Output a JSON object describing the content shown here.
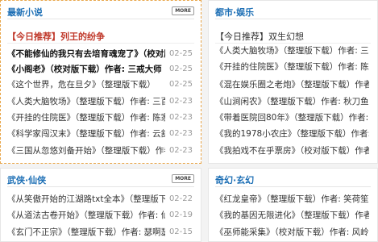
{
  "more_label": "MORE",
  "panels": [
    {
      "title": "最新小说",
      "featured": "【今日推荐】列王的纷争",
      "items": [
        {
          "title": "《不能修仙的我只有去培育魂宠了》（校对版",
          "date": "02-25",
          "hot": true
        },
        {
          "title": "《小阁老》（校对版下载）作者: 三戒大师",
          "date": "02-25",
          "hot": true
        },
        {
          "title": "《这个世界，危在旦夕》（整理版下载）",
          "date": "02-25"
        },
        {
          "title": "《人类大脑牧场》（整理版下载）作者: 三百",
          "date": "02-23"
        },
        {
          "title": "《开挂的住院医》（整理版下载）作者: 陈家",
          "date": "02-23"
        },
        {
          "title": "《科学家闯汉末》（整理版下载）作者: 云舒兄",
          "date": "02-23"
        },
        {
          "title": "《三国从忽悠刘备开始》（整理版下载）作者",
          "date": "02-23"
        }
      ]
    },
    {
      "title": "都市·娱乐",
      "featured": "【今日推荐】双生幻想",
      "items": [
        {
          "title": "《人类大脑牧场》（整理版下载）作者: 三百"
        },
        {
          "title": "《开挂的住院医》（整理版下载）作者: 陈家"
        },
        {
          "title": "《混在娱乐圈之老炮》（整理版下载）作者"
        },
        {
          "title": "《山涧闲农》（整理版下载）作者: 秋刀鱼鱼"
        },
        {
          "title": "《带着医院回80年》（整理版下载）作者: 辣饺"
        },
        {
          "title": "《我的1978小农庄》（整理版下载）作者: 名窑"
        },
        {
          "title": "《我拍戏不在乎票房》（校对版下载）作者"
        }
      ]
    },
    {
      "title": "武侠·仙侠",
      "items": [
        {
          "title": "《从笑傲开始的江湖路txt全本》（整理版下载",
          "date": "02-22"
        },
        {
          "title": "《从道法古卷开始》（整理版下载）作者: 仙先",
          "date": "02-19"
        },
        {
          "title": "《玄门不正宗》（整理版下载）作者: 瑟啊瑟",
          "date": "02-15"
        }
      ]
    },
    {
      "title": "奇幻·玄幻",
      "items": [
        {
          "title": "《红龙皇帝》（整理版下载）作者: 笑荷笙"
        },
        {
          "title": "《我的基因无限进化》（整理版下载）作者"
        },
        {
          "title": "《巫师能采集》（校对版下载）作者: 风岭客"
        }
      ]
    }
  ],
  "colors": {
    "heading": "#1d6fb5",
    "hot_red": "#c0392b",
    "date": "#999999",
    "dashed_border": "#e8a64a"
  }
}
